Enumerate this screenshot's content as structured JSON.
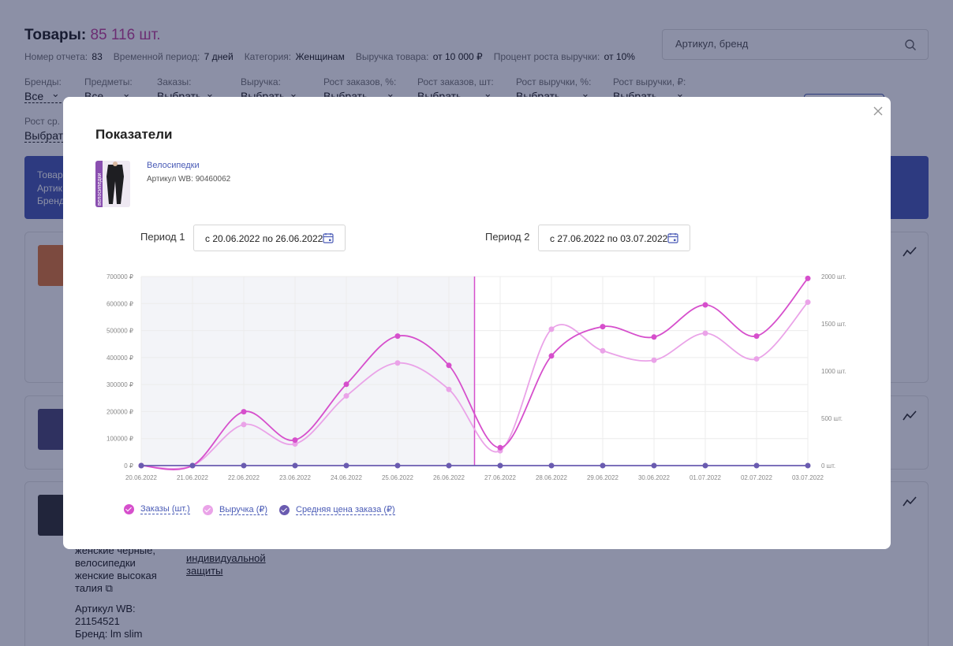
{
  "header": {
    "title": "Товары:",
    "count": "85 116 шт.",
    "meta": [
      {
        "key": "Номер отчета:",
        "value": "83"
      },
      {
        "key": "Временной период:",
        "value": "7 дней"
      },
      {
        "key": "Категория:",
        "value": "Женщинам"
      },
      {
        "key": "Выручка товара:",
        "value": "от 10 000 ₽"
      },
      {
        "key": "Процент роста выручки:",
        "value": "от 10%"
      }
    ],
    "search_placeholder": "Артикул, бренд"
  },
  "filters": [
    {
      "label": "Бренды:",
      "value": "Все"
    },
    {
      "label": "Предметы:",
      "value": "Все"
    },
    {
      "label": "Заказы:",
      "value": "Выбрать"
    },
    {
      "label": "Выручка:",
      "value": "Выбрать"
    },
    {
      "label": "Рост заказов, %:",
      "value": "Выбрать"
    },
    {
      "label": "Рост заказов, шт:",
      "value": "Выбрать"
    },
    {
      "label": "Рост выручки, %:",
      "value": "Выбрать"
    },
    {
      "label": "Рост выручки, ₽:",
      "value": "Выбрать"
    }
  ],
  "filter_row2": {
    "label": "Рост ср. ц",
    "value": "Выбрат"
  },
  "banner": {
    "line1": "Товар",
    "line2": "Артик",
    "line3": "Бренд"
  },
  "product_card": {
    "name_lines": [
      "женские черные,",
      "велосипедки",
      "женские высокая",
      "талия"
    ],
    "article": "Артикул WB:",
    "article_no": "21154521",
    "brand": "Бренд: lm slim",
    "category_lines": [
      "индивидуальной",
      "защиты"
    ]
  },
  "modal": {
    "title": "Показатели",
    "product_name": "Велосипедки",
    "article": "Артикул WB: 90460062",
    "product_image_text": "велосипедки",
    "period1_label": "Период 1",
    "period1_value": "с 20.06.2022 по 26.06.2022",
    "period2_label": "Период 2",
    "period2_value": "с 27.06.2022 по 03.07.2022"
  },
  "legend": [
    {
      "label": "Заказы (шт.)",
      "color": "#d64fcc"
    },
    {
      "label": "Выручка (₽)",
      "color": "#eaa3e8"
    },
    {
      "label": "Средняя цена заказа (₽)",
      "color": "#6a5bb0"
    }
  ],
  "chart_data": {
    "type": "line",
    "x": [
      "20.06.2022",
      "21.06.2022",
      "22.06.2022",
      "23.06.2022",
      "24.06.2022",
      "25.06.2022",
      "26.06.2022",
      "27.06.2022",
      "28.06.2022",
      "29.06.2022",
      "30.06.2022",
      "01.07.2022",
      "02.07.2022",
      "03.07.2022"
    ],
    "y_left_ticks": [
      "700000 ₽",
      "600000 ₽",
      "500000 ₽",
      "400000 ₽",
      "300000 ₽",
      "200000 ₽",
      "100000 ₽",
      "0 ₽"
    ],
    "y_right_ticks": [
      "2000 шт.",
      "1500 шт.",
      "1000 шт.",
      "500 шт.",
      "0 шт."
    ],
    "y_left_range": [
      0,
      700000
    ],
    "y_right_range": [
      0,
      2000
    ],
    "period_split_after": "26.06.2022",
    "series": [
      {
        "name": "Заказы (шт.)",
        "axis": "right",
        "color": "#d64fcc",
        "values": [
          0,
          0,
          570,
          270,
          860,
          1370,
          1060,
          190,
          1160,
          1470,
          1360,
          1700,
          1370,
          1980
        ]
      },
      {
        "name": "Выручка (₽)",
        "axis": "left",
        "color": "#eaa3e8",
        "values": [
          0,
          0,
          152000,
          80000,
          258000,
          380000,
          282000,
          55000,
          505000,
          425000,
          390000,
          490000,
          395000,
          605000
        ]
      },
      {
        "name": "Средняя цена заказа (₽)",
        "axis": "left",
        "color": "#6a5bb0",
        "values": [
          0,
          0,
          0,
          0,
          0,
          0,
          0,
          0,
          0,
          0,
          0,
          0,
          0,
          0
        ]
      }
    ]
  }
}
